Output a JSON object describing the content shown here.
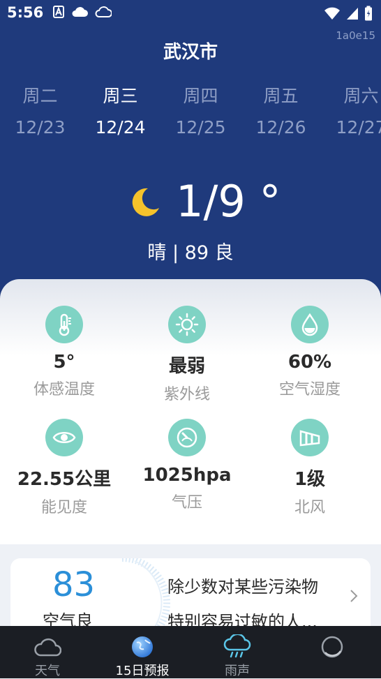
{
  "status_bar": {
    "time": "5:56",
    "build_id": "1a0e15"
  },
  "header": {
    "city": "武汉市"
  },
  "days": [
    {
      "weekday": "周二",
      "date": "12/23",
      "selected": false
    },
    {
      "weekday": "周三",
      "date": "12/24",
      "selected": true
    },
    {
      "weekday": "周四",
      "date": "12/25",
      "selected": false
    },
    {
      "weekday": "周五",
      "date": "12/26",
      "selected": false
    },
    {
      "weekday": "周六",
      "date": "12/27",
      "selected": false
    }
  ],
  "today": {
    "icon": "moon-icon",
    "temperature": "1/9 °",
    "condition": "晴 | 89 良"
  },
  "details": [
    {
      "icon": "thermometer-icon",
      "value": "5°",
      "label": "体感温度"
    },
    {
      "icon": "sun-icon",
      "value": "最弱",
      "label": "紫外线"
    },
    {
      "icon": "water-drop-icon",
      "value": "60%",
      "label": "空气湿度"
    },
    {
      "icon": "eye-icon",
      "value": "22.55公里",
      "label": "能见度"
    },
    {
      "icon": "gauge-icon",
      "value": "1025hpa",
      "label": "气压"
    },
    {
      "icon": "windsock-icon",
      "value": "1级",
      "label": "北风"
    }
  ],
  "air_quality": {
    "aqi": "83",
    "level": "空气良",
    "advice_line1": "除少数对某些污染物",
    "advice_line2": "特别容易过敏的人..."
  },
  "nav": [
    {
      "icon": "cloud-icon",
      "label": "天气",
      "active": false
    },
    {
      "icon": "globe-icon",
      "label": "15日预报",
      "active": true
    },
    {
      "icon": "rain-cloud-icon",
      "label": "雨声",
      "active": false
    },
    {
      "icon": "circle-icon",
      "label": "",
      "active": false
    }
  ],
  "colors": {
    "hero_bg": "#1f3a7c",
    "accent_teal": "#7fd3c4",
    "aqi_blue": "#2b8fd8",
    "moon_yellow": "#f5c22b",
    "nav_bg": "#1b1e24"
  }
}
